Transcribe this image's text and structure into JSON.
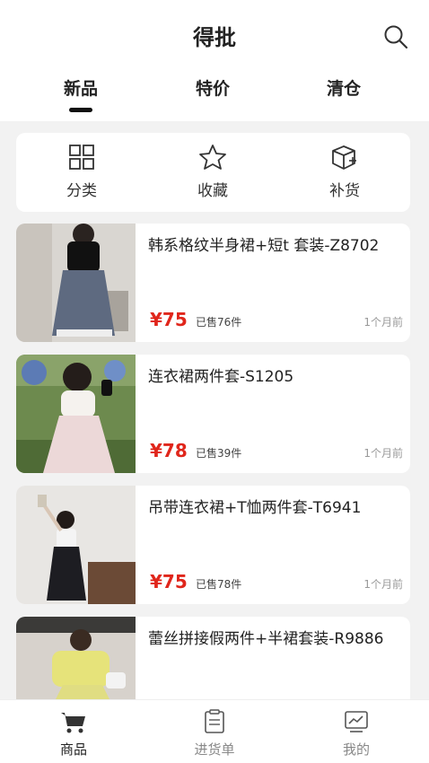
{
  "header": {
    "title": "得批",
    "tabs": [
      {
        "label": "新品",
        "active": true
      },
      {
        "label": "特价",
        "active": false
      },
      {
        "label": "清仓",
        "active": false
      }
    ]
  },
  "quick_actions": [
    {
      "label": "分类",
      "icon": "grid-icon"
    },
    {
      "label": "收藏",
      "icon": "star-icon"
    },
    {
      "label": "补货",
      "icon": "box-plus-icon"
    }
  ],
  "products": [
    {
      "name": "韩系格纹半身裙+短t 套装-Z8702",
      "price": "¥75",
      "sold": "已售76件",
      "time": "1个月前"
    },
    {
      "name": "连衣裙两件套-S1205",
      "price": "¥78",
      "sold": "已售39件",
      "time": "1个月前"
    },
    {
      "name": "吊带连衣裙+T恤两件套-T6941",
      "price": "¥75",
      "sold": "已售78件",
      "time": "1个月前"
    },
    {
      "name": "蕾丝拼接假两件+半裙套装-R9886",
      "price": "",
      "sold": "",
      "time": ""
    }
  ],
  "bottom_nav": [
    {
      "label": "商品",
      "icon": "cart-icon",
      "active": true
    },
    {
      "label": "进货单",
      "icon": "clipboard-icon",
      "active": false
    },
    {
      "label": "我的",
      "icon": "chart-monitor-icon",
      "active": false
    }
  ],
  "colors": {
    "price": "#e0261b",
    "background": "#f2f2f2",
    "active_underline": "#111111"
  }
}
